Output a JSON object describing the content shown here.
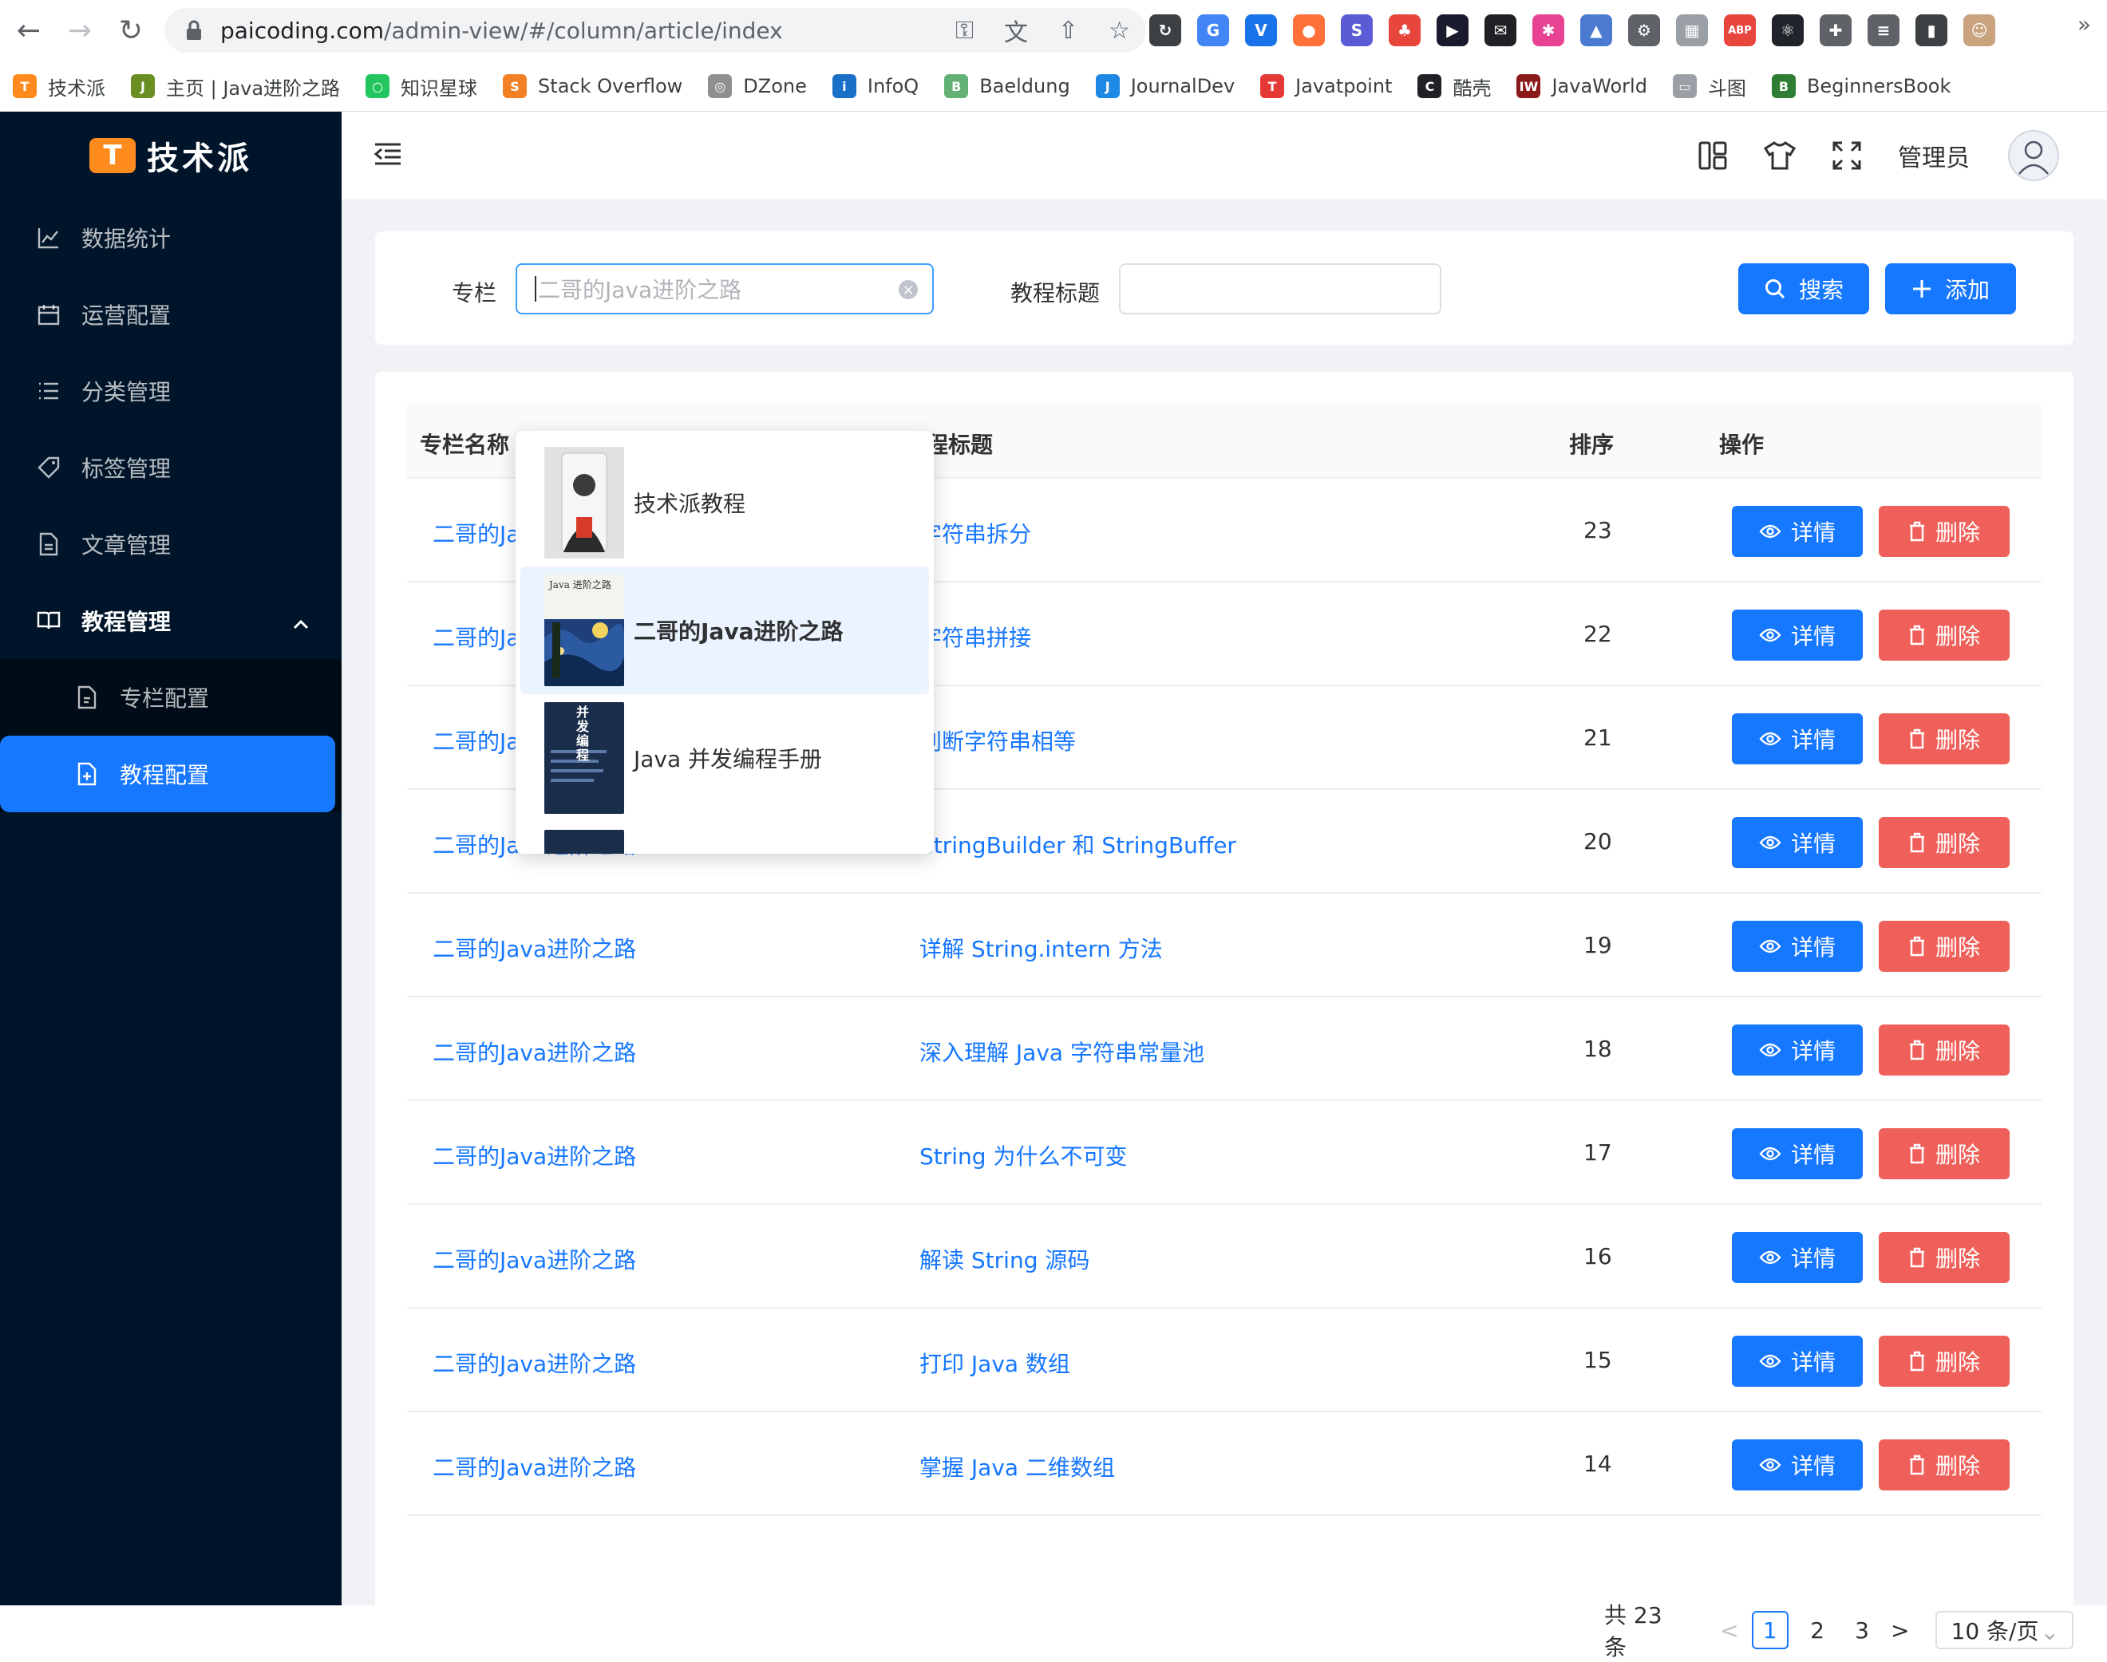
{
  "browser": {
    "url_host": "paicoding.com",
    "url_path": "/admin-view/#/column/article/index",
    "extensions": [
      {
        "name": "sync-icon",
        "color": "#3c4043",
        "label": "↻"
      },
      {
        "name": "google-translate-icon",
        "color": "#4285f4",
        "label": "G"
      },
      {
        "name": "vue-icon",
        "color": "#1a73e8",
        "label": "V"
      },
      {
        "name": "firefox-icon",
        "color": "#ff7139",
        "label": "●"
      },
      {
        "name": "split-icon",
        "color": "#5b5bd6",
        "label": "S"
      },
      {
        "name": "tree-icon",
        "color": "#e8453c",
        "label": "♣"
      },
      {
        "name": "play-icon",
        "color": "#1a1a2e",
        "label": "▶"
      },
      {
        "name": "chat-icon",
        "color": "#202124",
        "label": "✉"
      },
      {
        "name": "color-picker-icon",
        "color": "#e84393",
        "label": "✱"
      },
      {
        "name": "academic-icon",
        "color": "#4a7bd1",
        "label": "▲"
      },
      {
        "name": "openai-icon",
        "color": "#5f6368",
        "label": "⚙"
      },
      {
        "name": "window-icon",
        "color": "#9aa0a6",
        "label": "▦"
      },
      {
        "name": "adblock-icon",
        "color": "#e8453c",
        "label": "ABP"
      },
      {
        "name": "react-icon",
        "color": "#20232a",
        "label": "⚛"
      },
      {
        "name": "puzzle-icon",
        "color": "#5f6368",
        "label": "✚"
      },
      {
        "name": "playlist-icon",
        "color": "#5f6368",
        "label": "≡"
      },
      {
        "name": "sidepanel-icon",
        "color": "#3c4043",
        "label": "▮"
      },
      {
        "name": "profile-icon",
        "color": "#c9a27e",
        "label": "☺"
      }
    ],
    "bookmarks": [
      {
        "label": "技术派",
        "color": "#ff8a1e",
        "glyph": "T"
      },
      {
        "label": "主页 | Java进阶之路",
        "color": "#6b8e23",
        "glyph": "J"
      },
      {
        "label": "知识星球",
        "color": "#22c55e",
        "glyph": "○"
      },
      {
        "label": "Stack Overflow",
        "color": "#f48024",
        "glyph": "S"
      },
      {
        "label": "DZone",
        "color": "#8f8f8f",
        "glyph": "◎"
      },
      {
        "label": "InfoQ",
        "color": "#1a6fc7",
        "glyph": "i"
      },
      {
        "label": "Baeldung",
        "color": "#63b175",
        "glyph": "B"
      },
      {
        "label": "JournalDev",
        "color": "#1e88e5",
        "glyph": "J"
      },
      {
        "label": "Javatpoint",
        "color": "#e53935",
        "glyph": "T"
      },
      {
        "label": "酷壳",
        "color": "#202124",
        "glyph": "C"
      },
      {
        "label": "JavaWorld",
        "color": "#8b1a1a",
        "glyph": "IW"
      },
      {
        "label": "斗图",
        "color": "#9aa0a6",
        "glyph": "▭"
      },
      {
        "label": "BeginnersBook",
        "color": "#2e7d32",
        "glyph": "B"
      }
    ]
  },
  "app": {
    "logo_text": "技术派",
    "logo_mark": "T",
    "menu": [
      {
        "name": "menu-data-stats",
        "label": "数据统计",
        "icon": "chart-icon"
      },
      {
        "name": "menu-operations",
        "label": "运营配置",
        "icon": "calendar-icon"
      },
      {
        "name": "menu-category",
        "label": "分类管理",
        "icon": "list-icon"
      },
      {
        "name": "menu-tags",
        "label": "标签管理",
        "icon": "tag-icon"
      },
      {
        "name": "menu-articles",
        "label": "文章管理",
        "icon": "document-icon"
      }
    ],
    "menu_open": {
      "label": "教程管理"
    },
    "submenu": [
      {
        "label": "专栏配置"
      },
      {
        "label": "教程配置"
      }
    ],
    "header": {
      "user_label": "管理员"
    },
    "search": {
      "column_label": "专栏",
      "column_placeholder": "二哥的Java进阶之路",
      "title_label": "教程标题",
      "title_placeholder": "",
      "search_button": "搜索",
      "add_button": "添加"
    },
    "table": {
      "columns": [
        "专栏名称",
        "教程标题",
        "排序",
        "操作"
      ],
      "view_label": "详情",
      "delete_label": "删除",
      "rows": [
        {
          "column": "二哥的Java进阶之路",
          "title": "字符串拆分",
          "sort": "23"
        },
        {
          "column": "二哥的Java进阶之路",
          "title": "字符串拼接",
          "sort": "22"
        },
        {
          "column": "二哥的Java进阶之路",
          "title": "判断字符串相等",
          "sort": "21"
        },
        {
          "column": "二哥的Java进阶之路",
          "title": "StringBuilder 和 StringBuffer",
          "sort": "20"
        },
        {
          "column": "二哥的Java进阶之路",
          "title": "详解 String.intern 方法",
          "sort": "19"
        },
        {
          "column": "二哥的Java进阶之路",
          "title": "深入理解 Java 字符串常量池",
          "sort": "18"
        },
        {
          "column": "二哥的Java进阶之路",
          "title": "String 为什么不可变",
          "sort": "17"
        },
        {
          "column": "二哥的Java进阶之路",
          "title": "解读 String 源码",
          "sort": "16"
        },
        {
          "column": "二哥的Java进阶之路",
          "title": "打印 Java 数组",
          "sort": "15"
        },
        {
          "column": "二哥的Java进阶之路",
          "title": "掌握 Java 二维数组",
          "sort": "14"
        }
      ]
    },
    "pagination": {
      "total": "共 23 条",
      "pages": [
        "1",
        "2",
        "3"
      ],
      "current": "1",
      "page_size": "10 条/页"
    },
    "dropdown": {
      "options": [
        {
          "label": "技术派教程",
          "cover": "portrait"
        },
        {
          "label": "二哥的Java进阶之路",
          "cover": "starry",
          "cover_text": "Java 进阶之路"
        },
        {
          "label": "Java 并发编程手册",
          "cover": "dark",
          "cover_text": "并发编程"
        }
      ]
    }
  }
}
